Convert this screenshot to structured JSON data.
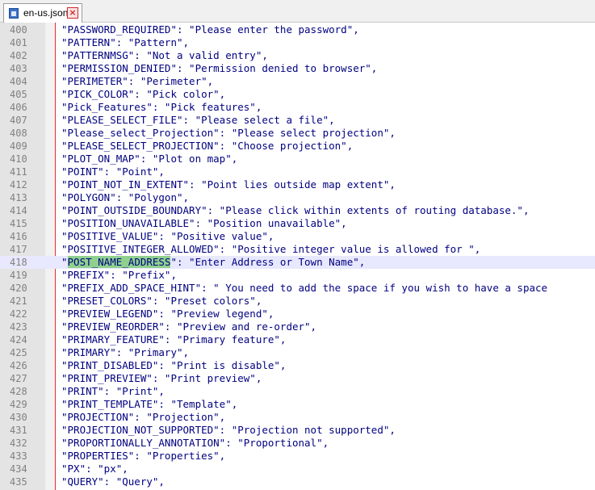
{
  "tab": {
    "title": "en-us.json",
    "icon": "json-file-icon",
    "close_icon": "close-tab-icon"
  },
  "editor": {
    "current_line": "418",
    "lines": [
      {
        "n": "400",
        "code": "\"PASSWORD_REQUIRED\": \"Please enter the password\","
      },
      {
        "n": "401",
        "code": "\"PATTERN\": \"Pattern\","
      },
      {
        "n": "402",
        "code": "\"PATTERNMSG\": \"Not a valid entry\","
      },
      {
        "n": "403",
        "code": "\"PERMISSION_DENIED\": \"Permission denied to browser\","
      },
      {
        "n": "404",
        "code": "\"PERIMETER\": \"Perimeter\","
      },
      {
        "n": "405",
        "code": "\"PICK_COLOR\": \"Pick color\","
      },
      {
        "n": "406",
        "code": "\"Pick_Features\": \"Pick features\","
      },
      {
        "n": "407",
        "code": "\"PLEASE_SELECT_FILE\": \"Please select a file\","
      },
      {
        "n": "408",
        "code": "\"Please_select_Projection\": \"Please select projection\","
      },
      {
        "n": "409",
        "code": "\"PLEASE_SELECT_PROJECTION\": \"Choose projection\","
      },
      {
        "n": "410",
        "code": "\"PLOT_ON_MAP\": \"Plot on map\","
      },
      {
        "n": "411",
        "code": "\"POINT\": \"Point\","
      },
      {
        "n": "412",
        "code": "\"POINT_NOT_IN_EXTENT\": \"Point lies outside map extent\","
      },
      {
        "n": "413",
        "code": "\"POLYGON\": \"Polygon\","
      },
      {
        "n": "414",
        "code": "\"POINT_OUTSIDE_BOUNDARY\": \"Please click within extents of routing database.\","
      },
      {
        "n": "415",
        "code": "\"POSITION_UNAVAILABLE\": \"Position unavailable\","
      },
      {
        "n": "416",
        "code": "\"POSITIVE_VALUE\": \"Positive value\","
      },
      {
        "n": "417",
        "code": "\"POSITIVE_INTEGER_ALLOWED\": \"Positive integer value is allowed for \","
      },
      {
        "n": "418",
        "pre": "\"",
        "hl": "POST_NAME_ADDRESS",
        "post": "\": \"Enter Address or Town Name\","
      },
      {
        "n": "419",
        "code": "\"PREFIX\": \"Prefix\","
      },
      {
        "n": "420",
        "code": "\"PREFIX_ADD_SPACE_HINT\": \" You need to add the space if you wish to have a space"
      },
      {
        "n": "421",
        "code": "\"PRESET_COLORS\": \"Preset colors\","
      },
      {
        "n": "422",
        "code": "\"PREVIEW_LEGEND\": \"Preview legend\","
      },
      {
        "n": "423",
        "code": "\"PREVIEW_REORDER\": \"Preview and re-order\","
      },
      {
        "n": "424",
        "code": "\"PRIMARY_FEATURE\": \"Primary feature\","
      },
      {
        "n": "425",
        "code": "\"PRIMARY\": \"Primary\","
      },
      {
        "n": "426",
        "code": "\"PRINT_DISABLED\": \"Print is disable\","
      },
      {
        "n": "427",
        "code": "\"PRINT_PREVIEW\": \"Print preview\","
      },
      {
        "n": "428",
        "code": "\"PRINT\": \"Print\","
      },
      {
        "n": "429",
        "code": "\"PRINT_TEMPLATE\": \"Template\","
      },
      {
        "n": "430",
        "code": "\"PROJECTION\": \"Projection\","
      },
      {
        "n": "431",
        "code": "\"PROJECTION_NOT_SUPPORTED\": \"Projection not supported\","
      },
      {
        "n": "432",
        "code": "\"PROPORTIONALLY_ANNOTATION\": \"Proportional\","
      },
      {
        "n": "433",
        "code": "\"PROPERTIES\": \"Properties\","
      },
      {
        "n": "434",
        "code": "\"PX\": \"px\","
      },
      {
        "n": "435",
        "code": "\"QUERY\": \"Query\","
      }
    ]
  }
}
